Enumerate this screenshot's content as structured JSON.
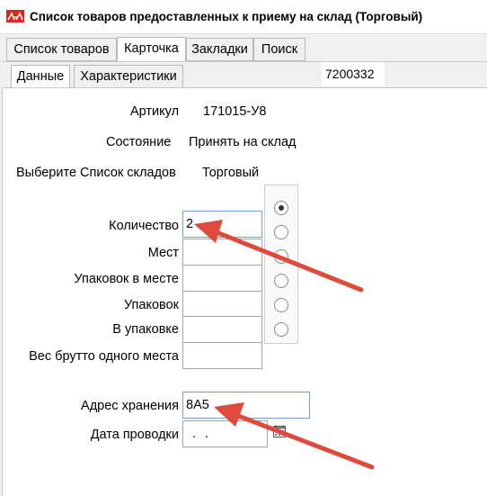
{
  "window": {
    "title": "Список товаров предоставленных к приему на склад (Торговый)",
    "app_icon": "red-logo-icon"
  },
  "tabs": [
    {
      "label": "Список товаров",
      "active": false
    },
    {
      "label": "Карточка",
      "active": true
    },
    {
      "label": "Закладки",
      "active": false
    },
    {
      "label": "Поиск",
      "active": false
    }
  ],
  "subtabs": [
    {
      "label": "Данные",
      "active": true
    },
    {
      "label": "Характеристики",
      "active": false
    }
  ],
  "record_code": "7200332",
  "info": {
    "article_label": "Артикул",
    "article_value": "171015-У8",
    "state_label": "Состояние",
    "state_value": "Принять на склад",
    "warehouse_label": "Выберите Список складов",
    "warehouse_value": "Торговый"
  },
  "fields": {
    "quantity": {
      "label": "Количество",
      "value": "2"
    },
    "places": {
      "label": "Мест",
      "value": ""
    },
    "packs_per_place": {
      "label": "Упаковок в месте",
      "value": ""
    },
    "packs": {
      "label": "Упаковок",
      "value": ""
    },
    "per_pack": {
      "label": "В упаковке",
      "value": ""
    },
    "gross_weight": {
      "label": "Вес брутто одного места",
      "value": ""
    },
    "storage_address": {
      "label": "Адрес хранения",
      "value": "8A5"
    },
    "posting_date": {
      "label": "Дата проводки",
      "value": ". ."
    }
  },
  "radio_selected_index": 0,
  "colors": {
    "arrow": "#e04a3c",
    "logo": "#e2231a",
    "focus_border": "#6f9fd8"
  }
}
